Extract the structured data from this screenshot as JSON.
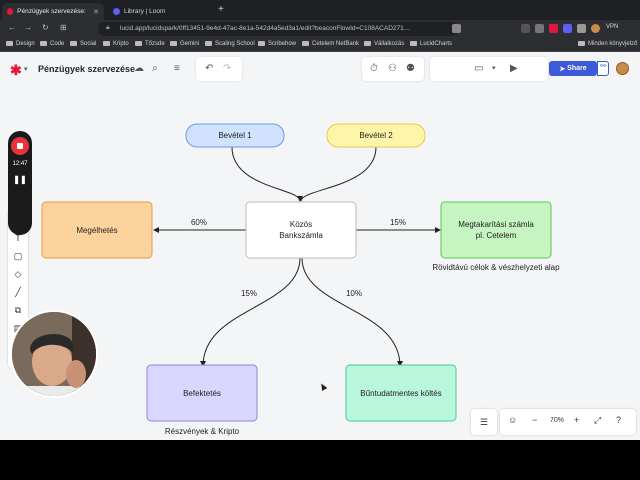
{
  "browser": {
    "tabs": [
      {
        "label": "Pénzügyek szervezése: Luc",
        "active": true
      },
      {
        "label": "Library | Loom",
        "active": false
      }
    ],
    "url": "lucid.app/lucidspark/0ff13451-9e4d-47ac-8e1a-542d4a5ed3a1/edit?beaconFlowId=C108ACAD271…",
    "vpn": "VPN",
    "bookmarks": [
      "Design",
      "Code",
      "Social",
      "Kripto",
      "Tőzsde",
      "Gemini",
      "Scaling School",
      "Scribehow",
      "Cetelem NetBank",
      "Vállalkozás",
      "LucidCharts"
    ],
    "bookmarks_right": "Minden könyvjelző"
  },
  "header": {
    "doc_title": "Pénzügyek szervezése",
    "share_label": "Share"
  },
  "recorder": {
    "time": "12:47"
  },
  "diagram": {
    "shapes": {
      "income1": "Bevétel 1",
      "income2": "Bevétel 2",
      "joint": [
        "Közös",
        "Bankszámla"
      ],
      "living": "Megélhetés",
      "savings": [
        "Megtakarítási számla",
        "pl. Cetelem"
      ],
      "invest": "Befektetés",
      "guiltfree": "Bűntudatmentes költés"
    },
    "connector_labels": {
      "living": "60%",
      "savings": "15%",
      "invest": "15%",
      "guiltfree": "10%"
    },
    "notes": {
      "savings_note": "Rövidtávú célok & vészhelyzeti alap",
      "invest_note": "Részvények & Kripto"
    }
  },
  "zoom": {
    "level": "70%"
  },
  "colors": {
    "income1_fill": "#cfe2ff",
    "income1_stroke": "#6b9be0",
    "income2_fill": "#fff5a8",
    "income2_stroke": "#e0cc4c",
    "living_fill": "#fcd39c",
    "living_stroke": "#e39b3d",
    "savings_fill": "#c6f5c1",
    "savings_stroke": "#5cc25c",
    "invest_fill": "#d9d6ff",
    "invest_stroke": "#8c86d9",
    "guiltfree_fill": "#b8f7dc",
    "guiltfree_stroke": "#4cc797",
    "accent": "#3d5bd9",
    "brand": "#e3173e"
  }
}
